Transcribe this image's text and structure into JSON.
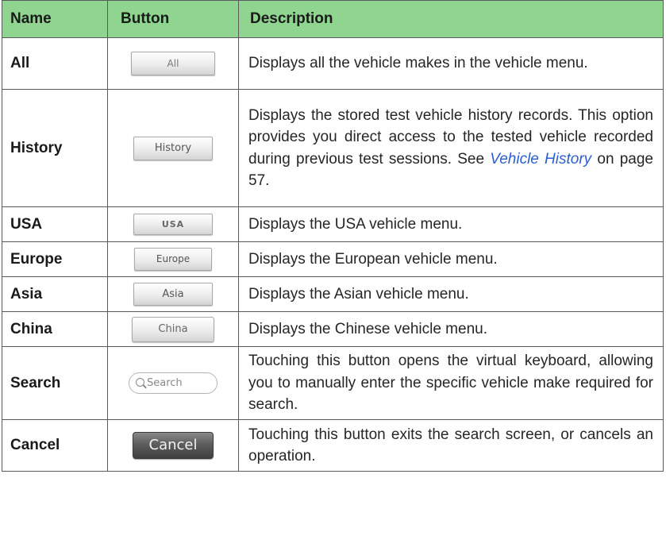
{
  "headers": {
    "name": "Name",
    "button": "Button",
    "description": "Description"
  },
  "rows": [
    {
      "name": "All",
      "button_label": "All",
      "description": "Displays all the vehicle makes in the vehicle menu."
    },
    {
      "name": "History",
      "button_label": "History",
      "description_before": "Displays the stored test vehicle history records. This option provides you direct access to the tested vehicle recorded during previous test sessions. See ",
      "description_link": "Vehicle History",
      "description_after": " on page 57."
    },
    {
      "name": "USA",
      "button_label": "USA",
      "description": "Displays the USA vehicle menu."
    },
    {
      "name": "Europe",
      "button_label": "Europe",
      "description": "Displays the European vehicle menu."
    },
    {
      "name": "Asia",
      "button_label": "Asia",
      "description": "Displays the Asian vehicle menu."
    },
    {
      "name": "China",
      "button_label": "China",
      "description": "Displays the Chinese vehicle menu."
    },
    {
      "name": "Search",
      "button_label": "Search",
      "button_icon": "search-icon",
      "description": "Touching this button opens the virtual keyboard, allowing you to manually enter the specific vehicle make required for search."
    },
    {
      "name": "Cancel",
      "button_label": "Cancel",
      "description": "Touching this button exits the search screen, or cancels an operation."
    }
  ],
  "colors": {
    "header_background": "#8fd48f",
    "link": "#2a5fd1",
    "border": "#5a5a5a"
  }
}
